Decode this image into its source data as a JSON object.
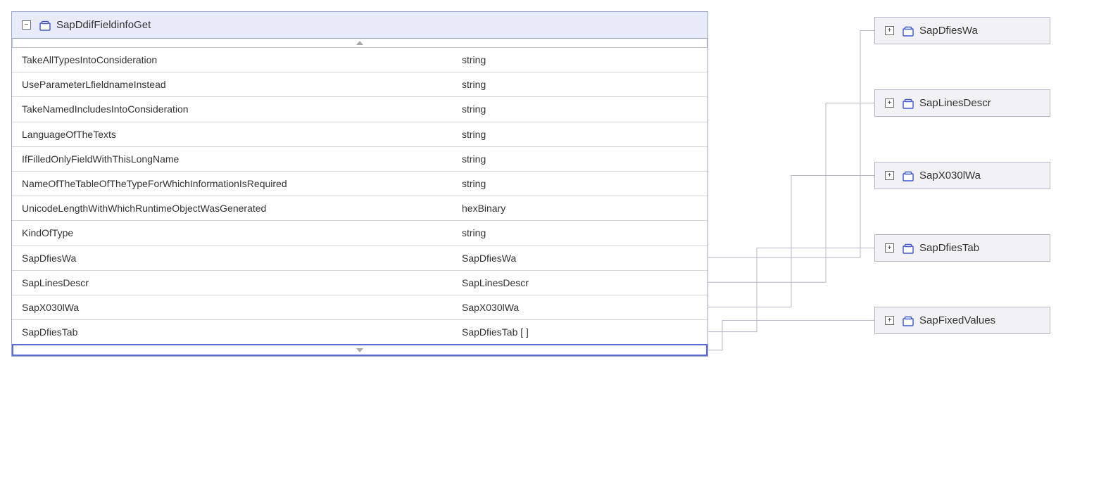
{
  "main_entity": {
    "title": "SapDdifFieldinfoGet",
    "collapse_glyph": "−",
    "fields": [
      {
        "name": "TakeAllTypesIntoConsideration",
        "type": "string"
      },
      {
        "name": "UseParameterLfieldnameInstead",
        "type": "string"
      },
      {
        "name": "TakeNamedIncludesIntoConsideration",
        "type": "string"
      },
      {
        "name": "LanguageOfTheTexts",
        "type": "string"
      },
      {
        "name": "IfFilledOnlyFieldWithThisLongName",
        "type": "string"
      },
      {
        "name": "NameOfTheTableOfTheTypeForWhichInformationIsRequired",
        "type": "string"
      },
      {
        "name": "UnicodeLengthWithWhichRuntimeObjectWasGenerated",
        "type": "hexBinary"
      },
      {
        "name": "KindOfType",
        "type": "string"
      },
      {
        "name": "SapDfiesWa",
        "type": "SapDfiesWa"
      },
      {
        "name": "SapLinesDescr",
        "type": "SapLinesDescr"
      },
      {
        "name": "SapX030lWa",
        "type": "SapX030lWa"
      },
      {
        "name": "SapDfiesTab",
        "type": "SapDfiesTab [ ]"
      }
    ]
  },
  "related_entities": [
    {
      "title": "SapDfiesWa",
      "expand_glyph": "+"
    },
    {
      "title": "SapLinesDescr",
      "expand_glyph": "+"
    },
    {
      "title": "SapX030lWa",
      "expand_glyph": "+"
    },
    {
      "title": "SapDfiesTab",
      "expand_glyph": "+"
    },
    {
      "title": "SapFixedValues",
      "expand_glyph": "+"
    }
  ],
  "connections": [
    {
      "from_field_index": 8,
      "to_related_index": 0
    },
    {
      "from_field_index": 9,
      "to_related_index": 1
    },
    {
      "from_field_index": 10,
      "to_related_index": 2
    },
    {
      "from_field_index": 11,
      "to_related_index": 3
    },
    {
      "from_bottom": true,
      "to_related_index": 4
    }
  ]
}
